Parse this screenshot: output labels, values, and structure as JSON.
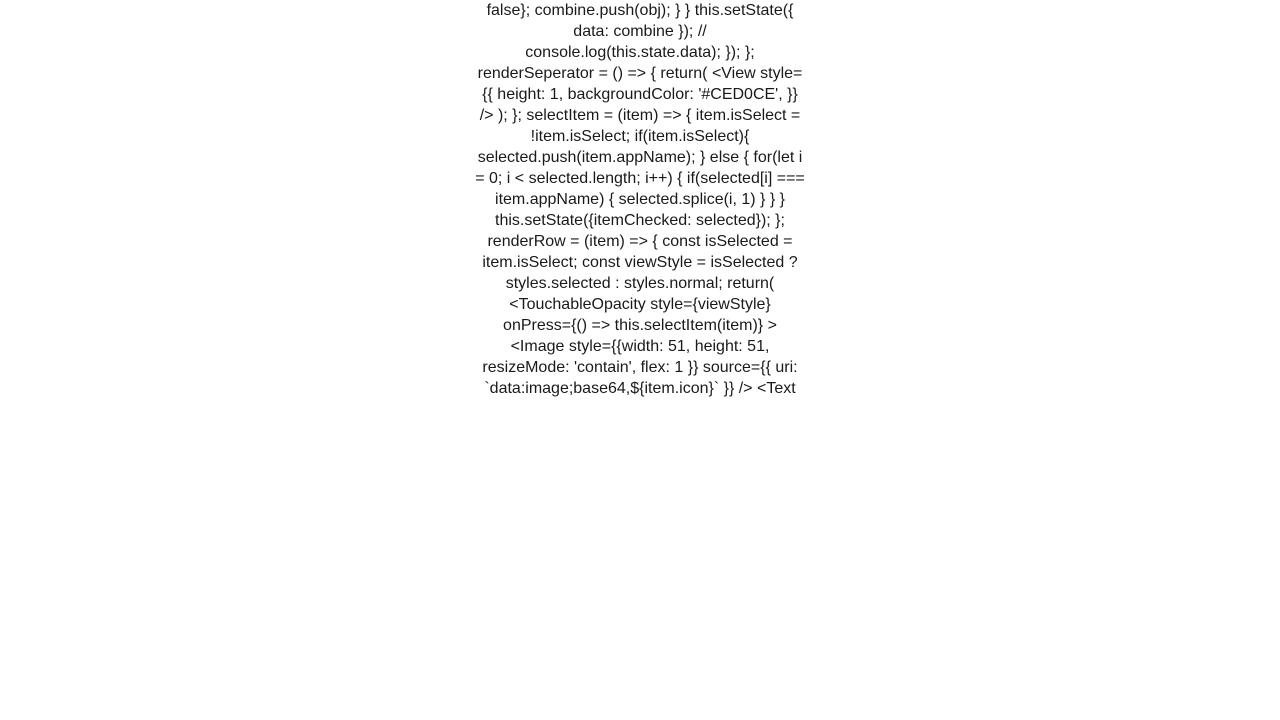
{
  "code_text": "false};                    combine.push(obj);                }            }            this.setState({                data: combine            });            // console.log(this.state.data);        });    };    renderSeperator = () => {        return(            <View                style={{                    height: 1,                    backgroundColor: '#CED0CE',                }}            />        );    };    selectItem = (item) => {        item.isSelect = !item.isSelect;        if(item.isSelect){            selected.push(item.appName);        }        else {            for(let i = 0; i < selected.length; i++) {                if(selected[i] === item.appName) {                    selected.splice(i, 1)                }            }        }        this.setState({itemChecked: selected});    };    renderRow = (item) => {        const isSelected = item.isSelect;        const viewStyle = isSelected ? styles.selected : styles.normal;        return(            <TouchableOpacity                style={viewStyle}                onPress={() => this.selectItem(item)}            >                <Image                    style={{width: 51, height: 51, resizeMode: 'contain', flex: 1 }}                    source={{ uri: `data:image;base64,${item.icon}` }}                />                <Text"
}
